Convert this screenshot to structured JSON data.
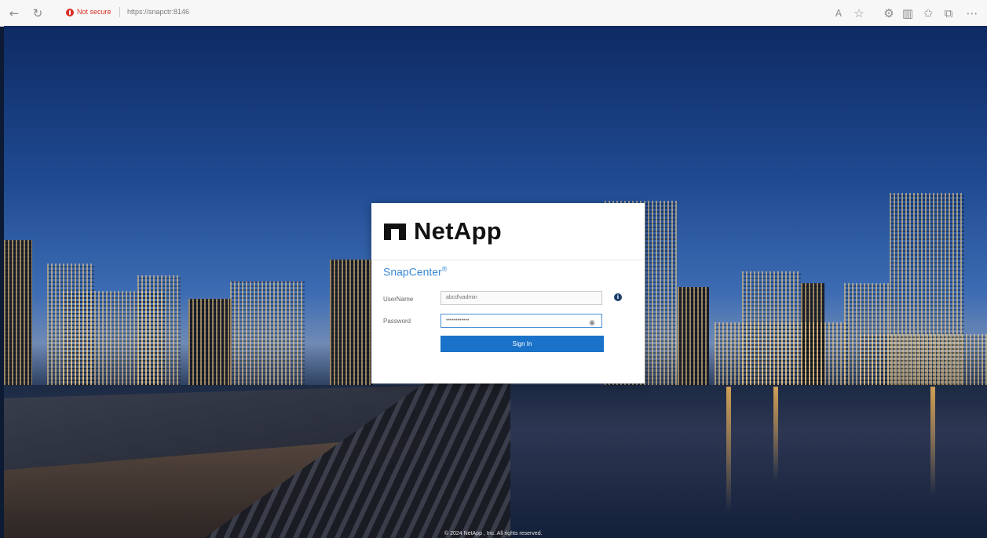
{
  "browser": {
    "back_icon": "back-arrow-icon",
    "reload_icon": "reload-icon",
    "security_text": "Not secure",
    "url": "https://snapctr:8146",
    "toolbar_icons": [
      "read-aloud-icon",
      "favorite-icon",
      "settings-icon",
      "split-screen-icon",
      "favorites-bar-icon",
      "collections-icon",
      "more-icon"
    ]
  },
  "login": {
    "brand": "NetApp",
    "product": "SnapCenter",
    "product_mark": "®",
    "username_label": "UserName",
    "username_value": "abcd\\vadmin",
    "password_label": "Password",
    "password_value": "••••••••••••",
    "signin_label": "Sign In",
    "accent_color": "#1a73c9"
  },
  "footer": {
    "copyright": "© 2024 NetApp , Inc. All rights reserved."
  }
}
